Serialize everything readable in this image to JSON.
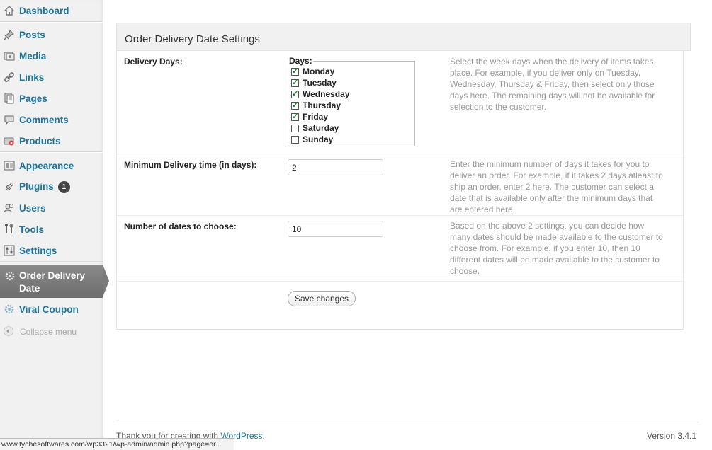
{
  "sidebar": {
    "items": [
      {
        "name": "dashboard",
        "label": "Dashboard",
        "icon": "home-icon"
      },
      {
        "name": "posts",
        "label": "Posts",
        "icon": "pushpin-icon"
      },
      {
        "name": "media",
        "label": "Media",
        "icon": "media-icon"
      },
      {
        "name": "links",
        "label": "Links",
        "icon": "link-icon"
      },
      {
        "name": "pages",
        "label": "Pages",
        "icon": "pages-icon"
      },
      {
        "name": "comments",
        "label": "Comments",
        "icon": "comment-bubble-icon"
      },
      {
        "name": "products",
        "label": "Products",
        "icon": "products-icon"
      },
      {
        "name": "appearance",
        "label": "Appearance",
        "icon": "appearance-icon"
      },
      {
        "name": "plugins",
        "label": "Plugins",
        "icon": "plug-icon",
        "badge": "1"
      },
      {
        "name": "users",
        "label": "Users",
        "icon": "users-icon"
      },
      {
        "name": "tools",
        "label": "Tools",
        "icon": "tools-icon"
      },
      {
        "name": "settings",
        "label": "Settings",
        "icon": "settings-sliders-icon"
      }
    ],
    "current": {
      "label": "Order Delivery Date",
      "icon": "gear-icon"
    },
    "after_current": {
      "label": "Viral Coupon",
      "icon": "gear-icon"
    },
    "collapse_label": "Collapse menu"
  },
  "panel": {
    "title": "Order Delivery Date Settings",
    "delivery_days": {
      "label": "Delivery Days:",
      "legend": "Days:",
      "days": [
        {
          "label": "Monday",
          "checked": true
        },
        {
          "label": "Tuesday",
          "checked": true
        },
        {
          "label": "Wednesday",
          "checked": true
        },
        {
          "label": "Thursday",
          "checked": true
        },
        {
          "label": "Friday",
          "checked": true
        },
        {
          "label": "Saturday",
          "checked": false
        },
        {
          "label": "Sunday",
          "checked": false
        }
      ],
      "description": "Select the week days when the delivery of items takes place. For example, if you deliver only on Tuesday, Wednesday, Thursday & Friday, then select only those days here. The remaining days will not be available for selection to the customer."
    },
    "min_delivery": {
      "label": "Minimum Delivery time (in days):",
      "value": "2",
      "description": "Enter the minimum number of days it takes for you to deliver an order. For example, if it takes 2 days atleast to ship an order, enter 2 here. The customer can select a date that is available only after the minimum days that are entered here."
    },
    "num_dates": {
      "label": "Number of dates to choose:",
      "value": "10",
      "description": "Based on the above 2 settings, you can decide how many dates should be made available to the customer to choose from. For example, if you enter 10, then 10 different dates will be made available to the customer to choose."
    },
    "save_label": "Save changes"
  },
  "footer": {
    "thanks_prefix": "Thank you for creating with ",
    "wordpress_link": "WordPress",
    "thanks_suffix": ".",
    "version": "Version 3.4.1"
  },
  "statusbar": {
    "url": "www.tychesoftwares.com/wp3321/wp-admin/admin.php?page=or..."
  },
  "colors": {
    "link": "#21759b",
    "current_menu": "#7b7b7b",
    "sidebar_bg": "#f1f1f1"
  }
}
